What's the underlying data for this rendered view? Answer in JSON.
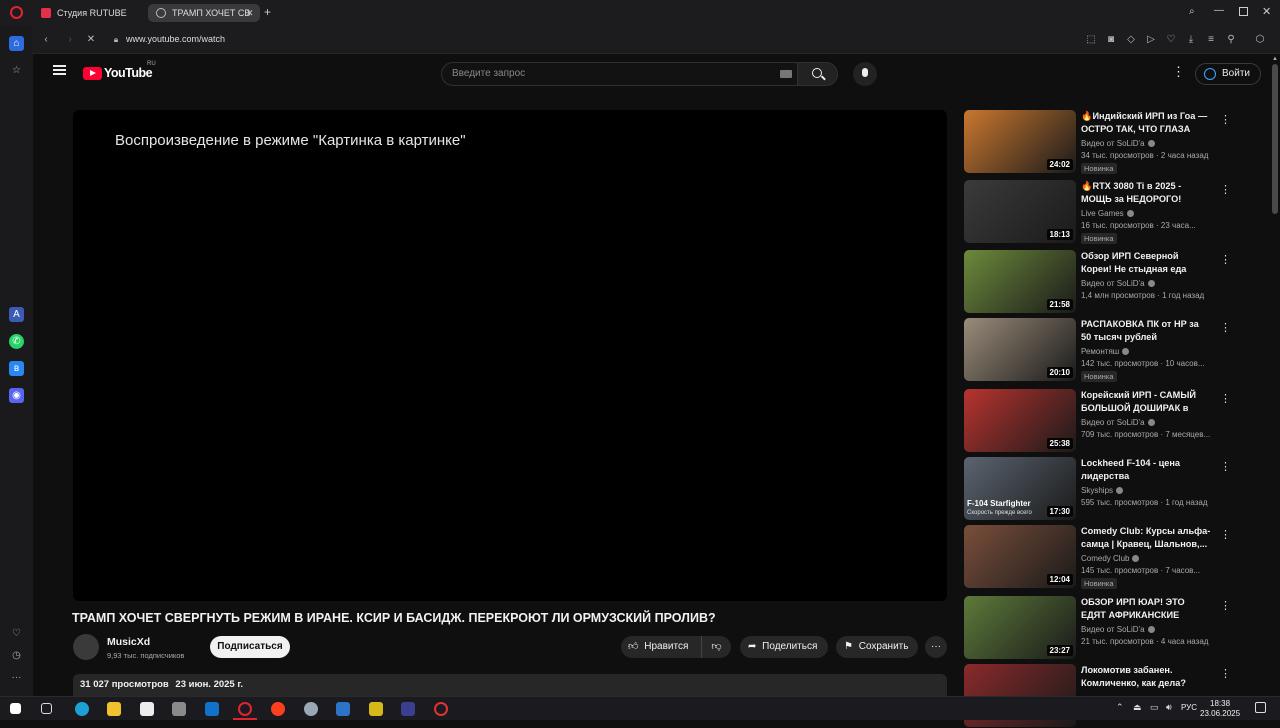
{
  "browser": {
    "tabs": [
      {
        "title": "Студия RUTUBE",
        "active": false,
        "color": "#e5304a"
      },
      {
        "title": "ТРАМП ХОЧЕТ СВ",
        "active": true,
        "color": "#cccccc"
      }
    ],
    "url": "www.youtube.com/watch"
  },
  "header": {
    "logo_text": "YouTube",
    "logo_region": "RU",
    "search_placeholder": "Введите запрос",
    "signin_label": "Войти"
  },
  "player": {
    "pip_message": "Воспроизведение в режиме \"Картинка в картинке\""
  },
  "video": {
    "title": "ТРАМП ХОЧЕТ СВЕРГНУТЬ РЕЖИМ В ИРАНЕ. КСИР И БАСИДЖ. ПЕРЕКРОЮТ ЛИ ОРМУЗСКИЙ ПРОЛИВ?",
    "channel_name": "MusicXd",
    "subscribers": "9,93 тыс. подписчиков",
    "subscribe_label": "Подписаться",
    "like_label": "Нравится",
    "share_label": "Поделиться",
    "save_label": "Сохранить",
    "views": "31 027 просмотров",
    "date": "23 июн. 2025 г."
  },
  "recommendations": [
    {
      "title": "🔥Индийский ИРП из Гоа — ОСТРО ТАК, ЧТО ГЛАЗА НА...",
      "channel": "Видео от SoLiD'a",
      "meta": "34 тыс. просмотров · 2 часа назад",
      "badge": "Новинка",
      "duration": "24:02",
      "thumb_color": "#c9772f"
    },
    {
      "title": "🔥RTX 3080 Ti в 2025 - МОЩЬ за НЕДОРОГО!",
      "channel": "Live Games",
      "meta": "16 тыс. просмотров · 23 часа...",
      "badge": "Новинка",
      "duration": "18:13",
      "thumb_color": "#3b3b3b"
    },
    {
      "title": "Обзор ИРП Северной Кореи! Не стыдная еда солдат!",
      "channel": "Видео от SoLiD'a",
      "meta": "1,4 млн просмотров · 1 год назад",
      "badge": "",
      "duration": "21:58",
      "thumb_color": "#6d8a3b"
    },
    {
      "title": "РАСПАКОВКА ПК от HP за 50 тысяч рублей",
      "channel": "Ремонтяш",
      "meta": "142 тыс. просмотров · 10 часов...",
      "badge": "Новинка",
      "duration": "20:10",
      "thumb_color": "#9a8c7a"
    },
    {
      "title": "Корейский ИРП - САМЫЙ БОЛЬШОЙ ДОШИРАК в мире...",
      "channel": "Видео от SoLiD'a",
      "meta": "709 тыс. просмотров · 7 месяцев...",
      "badge": "",
      "duration": "25:38",
      "thumb_color": "#b8332e"
    },
    {
      "title": "Lockheed F-104 - цена лидерства",
      "channel": "Skyships",
      "meta": "595 тыс. просмотров · 1 год назад",
      "badge": "",
      "duration": "17:30",
      "thumb_color": "#5a6470",
      "thumb_caption": "F-104 Starfighter",
      "thumb_subcaption": "Скорость прежде всего"
    },
    {
      "title": "Comedy Club: Курсы альфа-самца | Кравец, Шальнов,...",
      "channel": "Comedy Club",
      "meta": "145 тыс. просмотров · 7 часов...",
      "badge": "Новинка",
      "duration": "12:04",
      "thumb_color": "#7a4e3a"
    },
    {
      "title": "ОБЗОР ИРП ЮАР! ЭТО ЕДЯТ АФРИКАНСКИЕ СОЛДАТЫ?...",
      "channel": "Видео от SoLiD'a",
      "meta": "21 тыс. просмотров · 4 часа назад",
      "badge": "",
      "duration": "23:27",
      "thumb_color": "#5d7a3a"
    },
    {
      "title": "Локомотив забанен. Комличенко, как дела?",
      "channel": "",
      "meta": "",
      "badge": "",
      "duration": "",
      "thumb_color": "#8a2a2a"
    }
  ],
  "taskbar": {
    "language": "РУС",
    "time": "18:38",
    "date": "23.06.2025"
  }
}
